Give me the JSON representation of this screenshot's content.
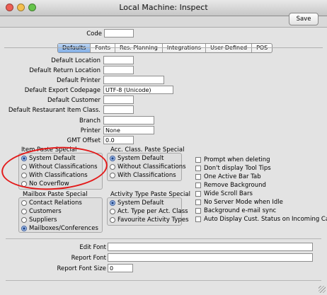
{
  "window": {
    "title": "Local Machine: Inspect",
    "traffic_colors": [
      "#ec5f55",
      "#f4bf4f",
      "#65c44a"
    ]
  },
  "toolbar": {
    "save_label": "Save"
  },
  "code": {
    "label": "Code",
    "value": ""
  },
  "tabs": [
    {
      "label": "Defaults",
      "active": true
    },
    {
      "label": "Fonts",
      "active": false
    },
    {
      "label": "Res. Planning",
      "active": false
    },
    {
      "label": "Integrations",
      "active": false
    },
    {
      "label": "User Defined",
      "active": false
    },
    {
      "label": "POS",
      "active": false
    }
  ],
  "fields": [
    {
      "label": "Default Location",
      "value": ""
    },
    {
      "label": "Default Return Location",
      "value": ""
    },
    {
      "label": "Default Printer",
      "value": ""
    },
    {
      "label": "Default Export Codepage",
      "value": "UTF-8 (Unicode)"
    },
    {
      "label": "Default Customer",
      "value": ""
    },
    {
      "label": "Default Restaurant Item Class.",
      "value": ""
    },
    {
      "label": "Branch",
      "value": ""
    },
    {
      "label": "Printer",
      "value": "None"
    },
    {
      "label": "GMT Offset",
      "value": "0.0"
    }
  ],
  "item_paste_special": {
    "title": "Item Paste Special",
    "options": [
      "System Default",
      "Without Classifications",
      "With Classifications",
      "No Coverflow"
    ],
    "selected": 0
  },
  "acc_class_paste_special": {
    "title": "Acc. Class. Paste Special",
    "options": [
      "System Default",
      "Without Classifications",
      "With Classifications"
    ],
    "selected": 0
  },
  "mailbox_paste_special": {
    "title": "Mailbox Paste Special",
    "options": [
      "Contact Relations",
      "Customers",
      "Suppliers",
      "Mailboxes/Conferences"
    ],
    "selected": 3
  },
  "activity_type_paste_special": {
    "title": "Activity Type Paste Special",
    "options": [
      "System Default",
      "Act. Type per Act. Class",
      "Favourite Activity Types"
    ],
    "selected": 0
  },
  "checkboxes": [
    "Prompt when deleting",
    "Don't display Tool Tips",
    "One Active Bar Tab",
    "Remove Background",
    "Wide Scroll Bars",
    "No Server Mode when Idle",
    "Background e-mail sync",
    "Auto Display Cust. Status on Incoming Calls"
  ],
  "fonts": [
    {
      "label": "Edit Font",
      "value": ""
    },
    {
      "label": "Report Font",
      "value": ""
    },
    {
      "label": "Report Font Size",
      "value": "0"
    }
  ],
  "annotation_color": "#e31b1b"
}
